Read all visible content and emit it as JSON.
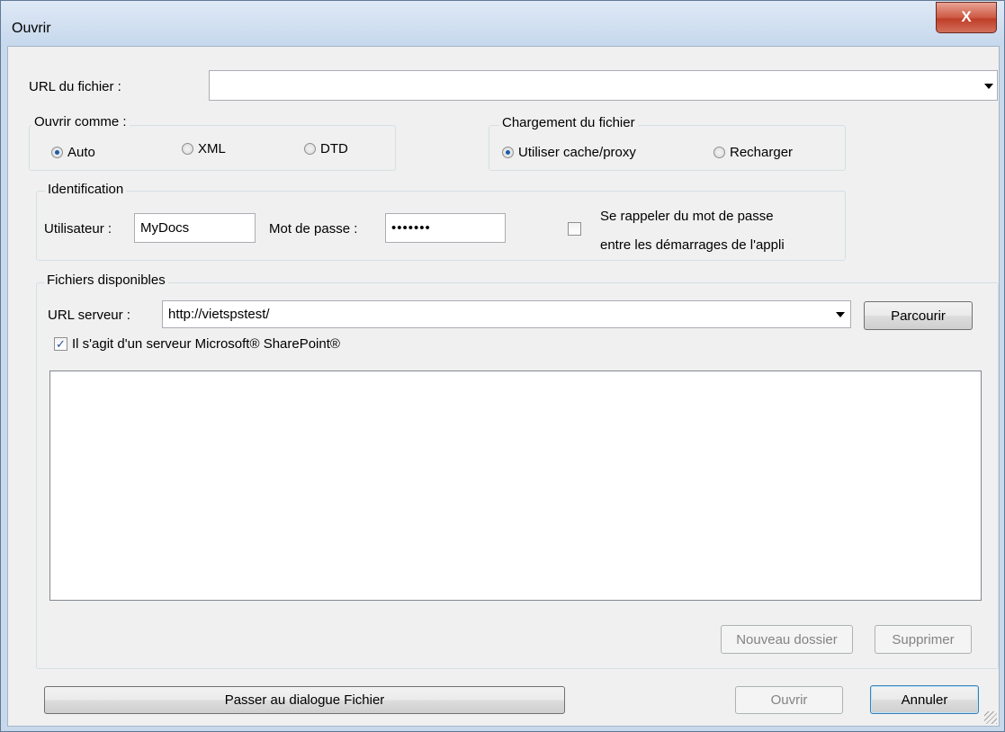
{
  "window": {
    "title": "Ouvrir",
    "close_glyph": "X"
  },
  "file_url": {
    "label": "URL du fichier :",
    "value": ""
  },
  "open_as": {
    "title": "Ouvrir comme :",
    "options": [
      "Auto",
      "XML",
      "DTD"
    ],
    "selected": "Auto"
  },
  "file_loading": {
    "title": "Chargement du fichier",
    "options": [
      "Utiliser cache/proxy",
      "Recharger"
    ],
    "selected": "Utiliser cache/proxy"
  },
  "identification": {
    "title": "Identification",
    "user_label": "Utilisateur :",
    "user_value": "MyDocs",
    "password_label": "Mot de passe :",
    "password_value": "•••••••",
    "remember_line1": "Se rappeler du mot de passe",
    "remember_line2": "entre les démarrages de l'appli",
    "remember_checked": false
  },
  "available_files": {
    "title": "Fichiers disponibles",
    "server_url_label": "URL serveur :",
    "server_url_value": "http://vietspstest/",
    "browse_label": "Parcourir",
    "sharepoint_label": "Il s'agit d'un serveur Microsoft® SharePoint®",
    "sharepoint_checked": true,
    "new_folder_label": "Nouveau dossier",
    "delete_label": "Supprimer"
  },
  "footer": {
    "switch_label": "Passer au dialogue Fichier",
    "open_label": "Ouvrir",
    "cancel_label": "Annuler"
  },
  "icons": {
    "close": "close-icon",
    "dropdown": "chevron-down-icon",
    "check": "checkmark-icon",
    "resize": "resize-grip-icon"
  }
}
